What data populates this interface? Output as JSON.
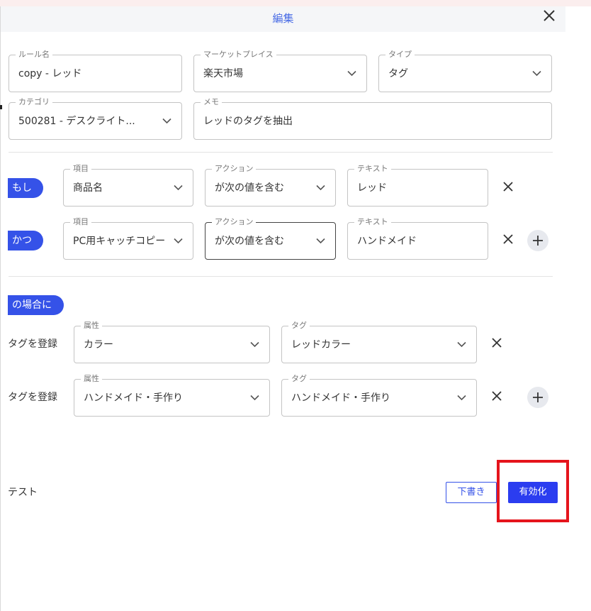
{
  "header": {
    "title": "編集"
  },
  "rule": {
    "name": {
      "label": "ルール名",
      "value": "copy - レッド"
    },
    "marketplace": {
      "label": "マーケットプレイス",
      "value": "楽天市場"
    },
    "type": {
      "label": "タイプ",
      "value": "タグ"
    },
    "category": {
      "label": "カテゴリ",
      "value": "500281 - デスクライト..."
    },
    "memo": {
      "label": "メモ",
      "value": "レッドのタグを抽出"
    }
  },
  "conditions": [
    {
      "connector": "もし",
      "item": {
        "label": "項目",
        "value": "商品名"
      },
      "action": {
        "label": "アクション",
        "value": "が次の値を含む"
      },
      "text": {
        "label": "テキスト",
        "value": "レッド"
      }
    },
    {
      "connector": "かつ",
      "item": {
        "label": "項目",
        "value": "PC用キャッチコピー"
      },
      "action": {
        "label": "アクション",
        "value": "が次の値を含む"
      },
      "text": {
        "label": "テキスト",
        "value": "ハンドメイド"
      }
    }
  ],
  "then_label": "の場合に",
  "actions": [
    {
      "label": "タグを登録",
      "attribute": {
        "label": "属性",
        "value": "カラー"
      },
      "tag": {
        "label": "タグ",
        "value": "レッドカラー"
      }
    },
    {
      "label": "タグを登録",
      "attribute": {
        "label": "属性",
        "value": "ハンドメイド・手作り"
      },
      "tag": {
        "label": "タグ",
        "value": "ハンドメイド・手作り"
      }
    }
  ],
  "footer": {
    "test_label": "テスト",
    "draft_label": "下書き",
    "enable_label": "有効化"
  },
  "colors": {
    "accent": "#3552e8",
    "primary_button": "#2b3df0",
    "highlight": "#e5141c",
    "header_title": "#4a6de5"
  },
  "icons": [
    "close-icon",
    "chevron-down-icon",
    "remove-icon",
    "plus-icon"
  ]
}
